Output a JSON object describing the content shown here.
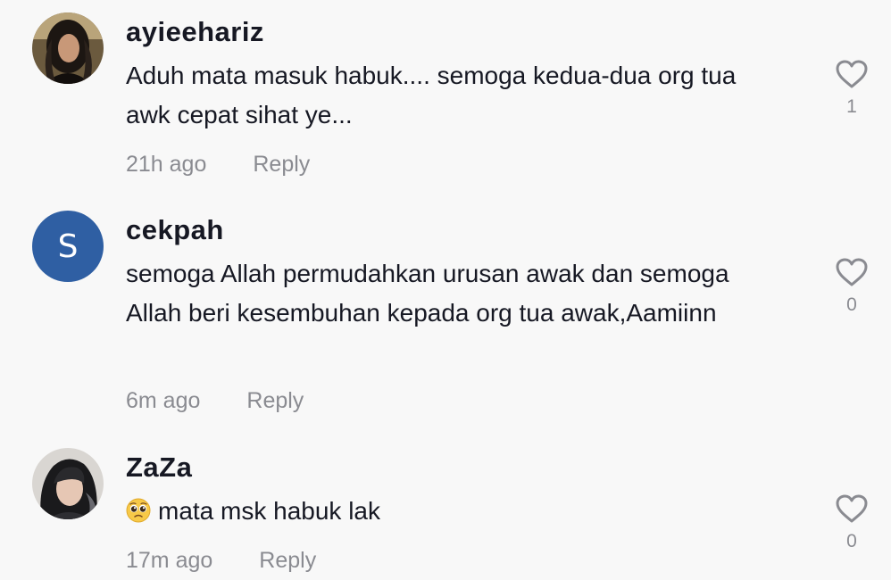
{
  "comments": [
    {
      "username": "ayieehariz",
      "text": "Aduh mata masuk habuk.... semoga kedua-dua org tua awk cepat sihat ye...",
      "time": "21h ago",
      "reply_label": "Reply",
      "like_count": "1",
      "avatar": "photo"
    },
    {
      "username": "cekpah",
      "text": "semoga Allah permudahkan urusan awak dan semoga Allah beri kesembuhan kepada org tua awak,Aamiinn",
      "time": "6m ago",
      "reply_label": "Reply",
      "like_count": "0",
      "avatar": "letter",
      "avatar_letter": "S",
      "avatar_color": "#2f5fa3"
    },
    {
      "username": "ZaZa",
      "text": "mata msk habuk lak",
      "emoji": "pleading-face-emoji",
      "time": "17m ago",
      "reply_label": "Reply",
      "like_count": "0",
      "avatar": "photo"
    }
  ],
  "icons": {
    "like": "heart-outline-icon"
  },
  "colors": {
    "text_primary": "#161823",
    "text_secondary": "#8a8b91",
    "background": "#f8f8f8"
  }
}
